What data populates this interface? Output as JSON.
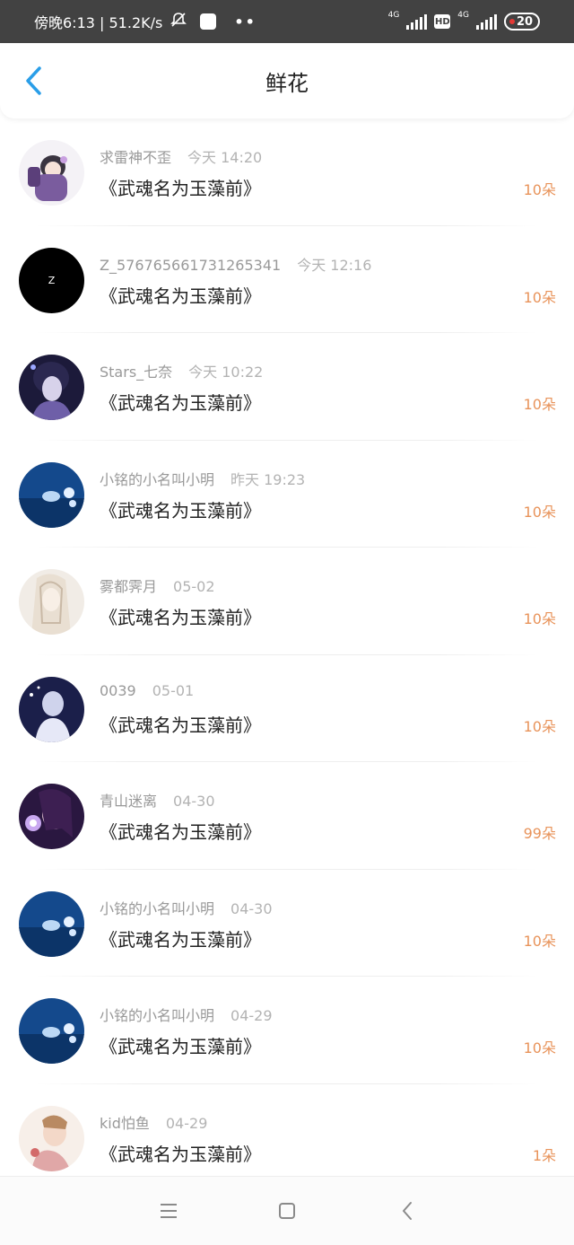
{
  "status_bar": {
    "time_text": "傍晚6:13 | 51.2K/s",
    "network_label_1": "4G",
    "network_label_2": "4G",
    "hd_label": "HD",
    "battery": "20",
    "more_dots": "••"
  },
  "header": {
    "title": "鲜花"
  },
  "items": [
    {
      "name": "求雷神不歪",
      "time": "今天 14:20",
      "book": "《武魂名为玉藻前》",
      "count": "10朵"
    },
    {
      "name": "Z_576765661731265341",
      "time": "今天 12:16",
      "book": "《武魂名为玉藻前》",
      "count": "10朵",
      "avatar_letter": "Z"
    },
    {
      "name": "Stars_七奈",
      "time": "今天 10:22",
      "book": "《武魂名为玉藻前》",
      "count": "10朵"
    },
    {
      "name": "小铭的小名叫小明",
      "time": "昨天 19:23",
      "book": "《武魂名为玉藻前》",
      "count": "10朵"
    },
    {
      "name": "雾都霁月",
      "time": "05-02",
      "book": "《武魂名为玉藻前》",
      "count": "10朵"
    },
    {
      "name": "0039",
      "time": "05-01",
      "book": "《武魂名为玉藻前》",
      "count": "10朵"
    },
    {
      "name": "青山迷离",
      "time": "04-30",
      "book": "《武魂名为玉藻前》",
      "count": "99朵"
    },
    {
      "name": "小铭的小名叫小明",
      "time": "04-30",
      "book": "《武魂名为玉藻前》",
      "count": "10朵"
    },
    {
      "name": "小铭的小名叫小明",
      "time": "04-29",
      "book": "《武魂名为玉藻前》",
      "count": "10朵"
    },
    {
      "name": "kid怕鱼",
      "time": "04-29",
      "book": "《武魂名为玉藻前》",
      "count": "1朵"
    }
  ],
  "colors": {
    "accent_blue": "#2a9ee8",
    "count_orange": "#e8935a",
    "status_bar_bg": "#424242"
  },
  "icons": {
    "back": "chevron-left-icon",
    "menu": "menu-icon",
    "home": "square-home-icon",
    "nav_back": "triangle-back-icon"
  }
}
